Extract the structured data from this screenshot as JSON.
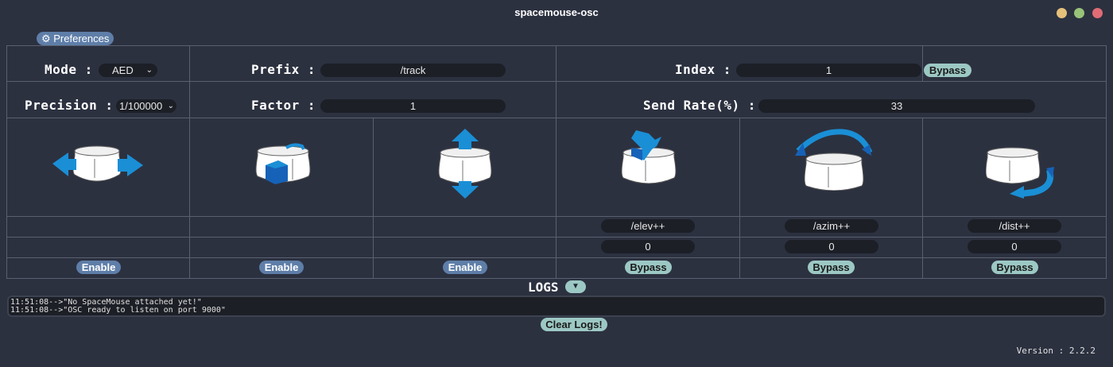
{
  "window": {
    "title": "spacemouse-osc",
    "controls": [
      {
        "name": "minimize",
        "color": "#e5c07b"
      },
      {
        "name": "maximize",
        "color": "#98c379"
      },
      {
        "name": "close",
        "color": "#e06c75"
      }
    ]
  },
  "preferences": {
    "label": "⚙ Preferences"
  },
  "settings": {
    "mode_label": "Mode :",
    "mode_value": "AED",
    "prefix_label": "Prefix :",
    "prefix_value": "/track",
    "index_label": "Index :",
    "index_value": "1",
    "index_bypass": "Bypass",
    "precision_label": "Precision :",
    "precision_value": "1/100000",
    "factor_label": "Factor :",
    "factor_value": "1",
    "sendrate_label": "Send Rate(%) :",
    "sendrate_value": "33"
  },
  "axes": [
    {
      "icon": "translate-x-icon",
      "address": "",
      "value": "",
      "button": "Enable",
      "button_type": "enable"
    },
    {
      "icon": "translate-y-icon",
      "address": "",
      "value": "",
      "button": "Enable",
      "button_type": "enable"
    },
    {
      "icon": "translate-z-icon",
      "address": "",
      "value": "",
      "button": "Enable",
      "button_type": "enable"
    },
    {
      "icon": "tilt-forward-icon",
      "address": "/elev++",
      "value": "0",
      "button": "Bypass",
      "button_type": "bypass"
    },
    {
      "icon": "rotate-icon",
      "address": "/azim++",
      "value": "0",
      "button": "Bypass",
      "button_type": "bypass"
    },
    {
      "icon": "tilt-side-icon",
      "address": "/dist++",
      "value": "0",
      "button": "Bypass",
      "button_type": "bypass"
    }
  ],
  "logs": {
    "label": "LOGS",
    "toggle": "▼",
    "lines": [
      "11:51:08-->\"No SpaceMouse attached yet!\"",
      "11:51:08-->\"OSC ready to listen on port 9000\""
    ],
    "clear_label": "Clear Logs!"
  },
  "version": "Version : 2.2.2",
  "colors": {
    "background": "#2c3140",
    "accent_blue": "#1a8fd6",
    "enable_button": "#5e7ea8",
    "bypass_button": "#9cc8c4"
  }
}
